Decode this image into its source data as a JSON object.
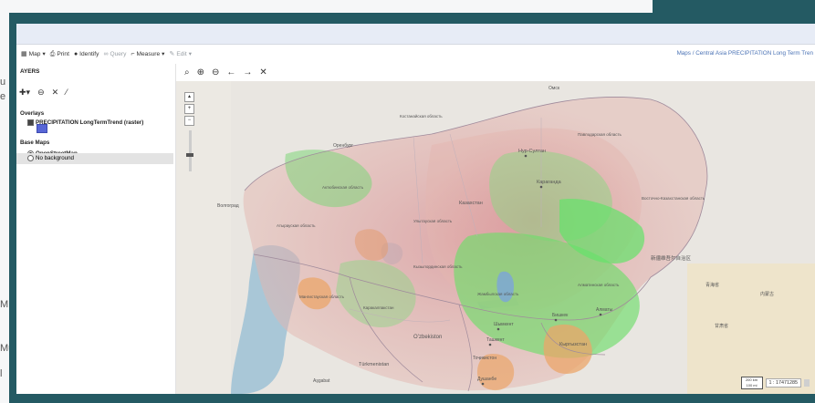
{
  "background": {
    "left_chars": [
      "u",
      "e",
      "M",
      "Mu",
      "l"
    ]
  },
  "toolbar": {
    "items": [
      {
        "label": "Map",
        "icon": "map-icon",
        "dropdown": true
      },
      {
        "label": "Print",
        "icon": "print-icon"
      },
      {
        "label": "Identify",
        "icon": "info-icon"
      },
      {
        "label": "Query",
        "icon": "binoculars-icon",
        "disabled": true
      },
      {
        "label": "Measure",
        "icon": "ruler-icon",
        "dropdown": true
      },
      {
        "label": "Edit",
        "icon": "edit-icon",
        "dropdown": true,
        "disabled": true
      }
    ],
    "breadcrumb": "Maps / Central Asia PRECIPITATION Long Term Tren"
  },
  "layers_panel": {
    "title": "AYERS",
    "tools": [
      "add-layer-icon",
      "remove-layer-icon",
      "wrench-icon",
      "brush-icon"
    ],
    "overlays_heading": "Overlays",
    "overlay_layer": "PRECIPITATION LongTermTrend (raster)",
    "overlay_checked": true,
    "legend_color": "#5866d6",
    "base_heading": "Base Maps",
    "base_layers": [
      {
        "label": "OpenStreetMap",
        "selected": true
      },
      {
        "label": "No background",
        "selected": false
      }
    ]
  },
  "map_toolbar": {
    "buttons": [
      "zoom-extent-icon",
      "zoom-in-icon",
      "zoom-out-icon",
      "back-arrow-icon",
      "forward-arrow-icon",
      "fullscreen-icon"
    ]
  },
  "map": {
    "labels": {
      "omsk": "Омск",
      "kostanay": "Костанайская область",
      "pavlodar": "Павлодарская область",
      "orenburg": "Оренбург",
      "nursultan": "Нур-Султан",
      "karaganda": "Караганда",
      "aktobe": "Актюбинская область",
      "kazakhstan": "Казахстан",
      "volgograd": "Волгоград",
      "ulytau": "Улытауская область",
      "vko": "Восточно-Казахстанская область",
      "atyrau": "Атырауская область",
      "kyzylorda": "Кызылординская область",
      "zhambyl": "Жамбылская область",
      "almaty_reg": "Алматинская область",
      "mangystau": "Мангистауская область",
      "karakalpak": "Каракалпакстан",
      "uzbekistan": "Oʻzbekiston",
      "shymkent": "Шымкент",
      "bishkek": "Бишкек",
      "almaty": "Алматы",
      "kyrgyzstan": "Кыргызстан",
      "tashkent": "Ташкент",
      "turkmenistan": "Türkmenistan",
      "tajik": "Тоҷикистон",
      "dushanbe": "Душанбе",
      "ashgabat": "Aşgabat",
      "xinjiang": "新疆维吾尔自治区",
      "china_a": "青海省",
      "china_b": "甘肃省",
      "china_c": "内蒙古"
    },
    "colors": {
      "sea": "#a8c6d8",
      "base": "#e9e3dc",
      "green": "#7ddb7a",
      "pink": "#d9a0a0",
      "orange": "#eba56a",
      "blue": "#7aa2e0"
    }
  },
  "scale": {
    "bar_top": "200 km",
    "bar_bottom": "100 mi",
    "value": "1 : 17471285"
  }
}
